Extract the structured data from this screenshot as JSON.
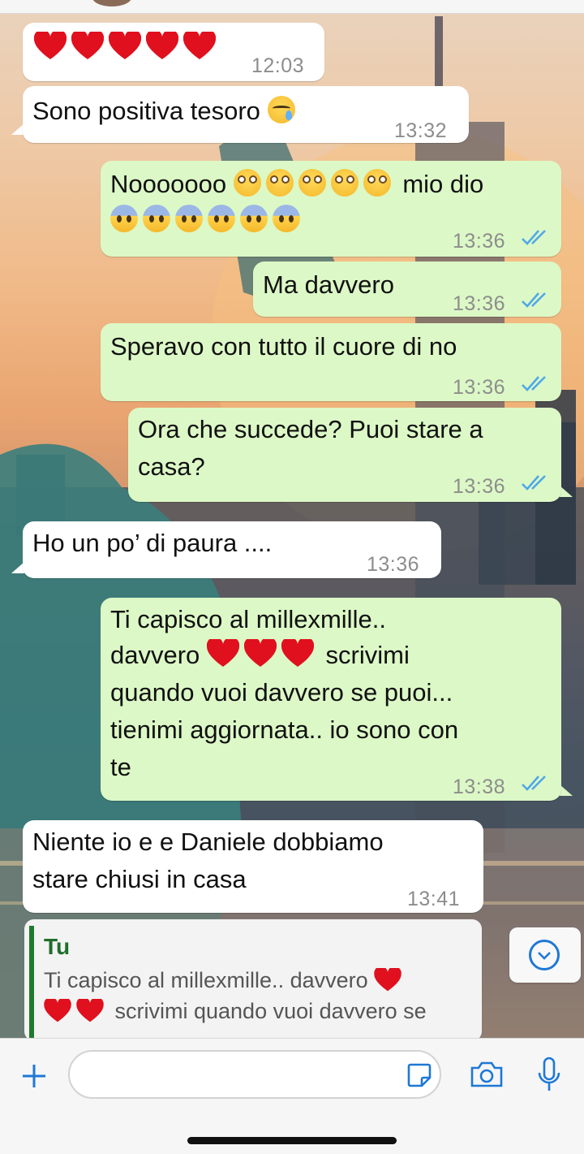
{
  "chat": {
    "messages": [
      {
        "id": "m1",
        "direction": "incoming",
        "text": "",
        "emoji": [
          "red-heart",
          "red-heart",
          "red-heart",
          "red-heart",
          "red-heart"
        ],
        "time": "12:03"
      },
      {
        "id": "m2",
        "direction": "incoming",
        "text": "Sono positiva tesoro",
        "emoji": [
          "crying-face"
        ],
        "time": "13:32"
      },
      {
        "id": "m3",
        "direction": "outgoing",
        "line1": "Nooooooo",
        "line1_end": "mio dio",
        "emoji_line1": [
          "flushed-face",
          "flushed-face",
          "flushed-face",
          "flushed-face",
          "flushed-face"
        ],
        "emoji_line2": [
          "fearful-face",
          "fearful-face",
          "fearful-face",
          "fearful-face",
          "fearful-face",
          "fearful-face"
        ],
        "time": "13:36",
        "status": "read"
      },
      {
        "id": "m4",
        "direction": "outgoing",
        "text": "Ma davvero",
        "time": "13:36",
        "status": "read"
      },
      {
        "id": "m5",
        "direction": "outgoing",
        "text": "Speravo con tutto il cuore di no",
        "time": "13:36",
        "status": "read"
      },
      {
        "id": "m6",
        "direction": "outgoing",
        "line1": "Ora che succede? Puoi stare a",
        "line2": "casa?",
        "time": "13:36",
        "status": "read"
      },
      {
        "id": "m7",
        "direction": "incoming",
        "text": "Ho un po’ di paura ....",
        "time": "13:36"
      },
      {
        "id": "m8",
        "direction": "outgoing",
        "line1": "Ti capisco al millexmille..",
        "line2a": "davvero",
        "line2b": "scrivimi",
        "line3": "quando vuoi davvero se puoi...",
        "line4": "tienimi aggiornata.. io sono con",
        "line5": "te",
        "emoji": [
          "red-heart",
          "red-heart",
          "red-heart"
        ],
        "time": "13:38",
        "status": "read"
      },
      {
        "id": "m9",
        "direction": "incoming",
        "line1": "Niente io e e Daniele dobbiamo",
        "line2": "stare chiusi in casa",
        "time": "13:41"
      }
    ],
    "reply": {
      "author": "Tu",
      "line1": "Ti capisco al millexmille.. davvero",
      "line2": "scrivimi quando vuoi davvero se"
    }
  },
  "icons": {
    "scroll_down": "chevron-down-circle-icon",
    "attach": "plus-icon",
    "sticker": "sticker-icon",
    "camera": "camera-icon",
    "mic": "microphone-icon"
  },
  "input": {
    "value": "",
    "placeholder": ""
  },
  "colors": {
    "incoming_bubble": "#ffffff",
    "outgoing_bubble": "#dcf8c6",
    "read_ticks": "#4fa8e8",
    "accent": "#1e78d6",
    "reply_author": "#1f6e2a"
  }
}
